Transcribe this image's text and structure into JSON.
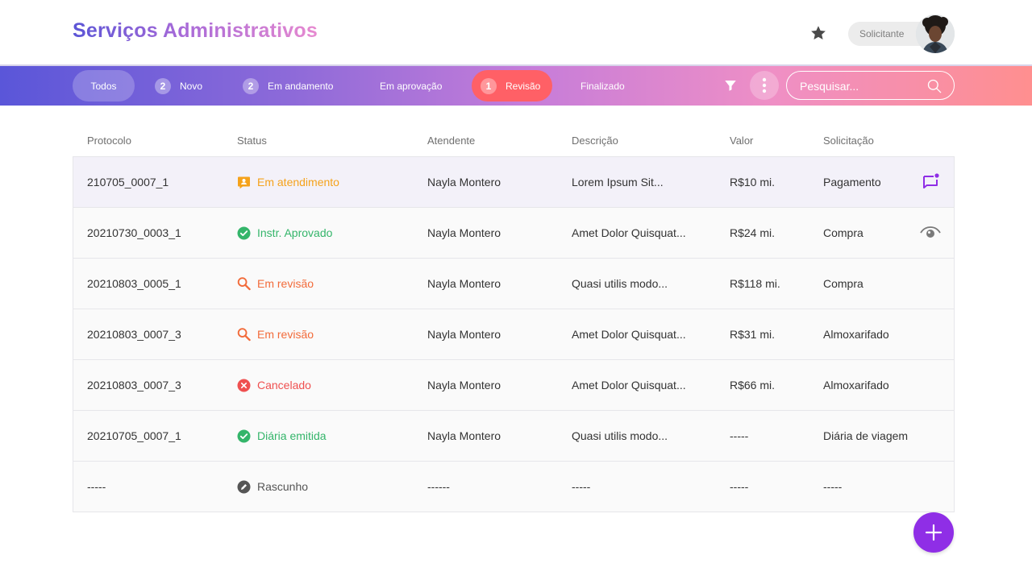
{
  "app": {
    "title": "Serviços Administrativos"
  },
  "user": {
    "role": "Solicitante"
  },
  "tabs": [
    {
      "label": "Todos",
      "count": ""
    },
    {
      "label": "Novo",
      "count": "2"
    },
    {
      "label": "Em andamento",
      "count": "2"
    },
    {
      "label": "Em aprovação",
      "count": ""
    },
    {
      "label": "Revisão",
      "count": "1"
    },
    {
      "label": "Finalizado",
      "count": ""
    }
  ],
  "search": {
    "placeholder": "Pesquisar..."
  },
  "table": {
    "columns": [
      "Protocolo",
      "Status",
      "Atendente",
      "Descrição",
      "Valor",
      "Solicitação"
    ],
    "rows": [
      {
        "protocolo": "210705_0007_1",
        "status": "Em atendimento",
        "status_icon": "person-badge-icon",
        "atendente": "Nayla Montero",
        "descricao": "Lorem Ipsum Sit...",
        "valor": "R$10 mi.",
        "solicitacao": "Pagamento",
        "action_icon": "chat-notification-icon"
      },
      {
        "protocolo": "20210730_0003_1",
        "status": "Instr. Aprovado",
        "status_icon": "check-circle-icon",
        "atendente": "Nayla Montero",
        "descricao": "Amet Dolor Quisquat...",
        "valor": "R$24 mi.",
        "solicitacao": "Compra",
        "action_icon": "eye-icon"
      },
      {
        "protocolo": "20210803_0005_1",
        "status": "Em revisão",
        "status_icon": "search-icon",
        "atendente": "Nayla Montero",
        "descricao": "Quasi utilis modo...",
        "valor": "R$118 mi.",
        "solicitacao": "Compra"
      },
      {
        "protocolo": "20210803_0007_3",
        "status": "Em revisão",
        "status_icon": "search-icon",
        "atendente": "Nayla Montero",
        "descricao": "Amet Dolor Quisquat...",
        "valor": "R$31 mi.",
        "solicitacao": "Almoxarifado"
      },
      {
        "protocolo": "20210803_0007_3",
        "status": "Cancelado",
        "status_icon": "x-circle-icon",
        "atendente": "Nayla Montero",
        "descricao": "Amet Dolor Quisquat...",
        "valor": "R$66 mi.",
        "solicitacao": "Almoxarifado"
      },
      {
        "protocolo": "20210705_0007_1",
        "status": "Diária emitida",
        "status_icon": "check-circle-icon",
        "atendente": "Nayla Montero",
        "descricao": "Quasi utilis modo...",
        "valor": "-----",
        "solicitacao": "Diária de viagem"
      },
      {
        "protocolo": "-----",
        "status": "Rascunho",
        "status_icon": "pencil-circle-icon",
        "atendente": "------",
        "descricao": "-----",
        "valor": "-----",
        "solicitacao": "-----"
      }
    ]
  },
  "colors": {
    "orange": "#f5a21b",
    "green": "#34b56a",
    "coral": "#f26b3a",
    "red": "#ef5050",
    "gray": "#555555",
    "purple": "#8f2ee6"
  }
}
